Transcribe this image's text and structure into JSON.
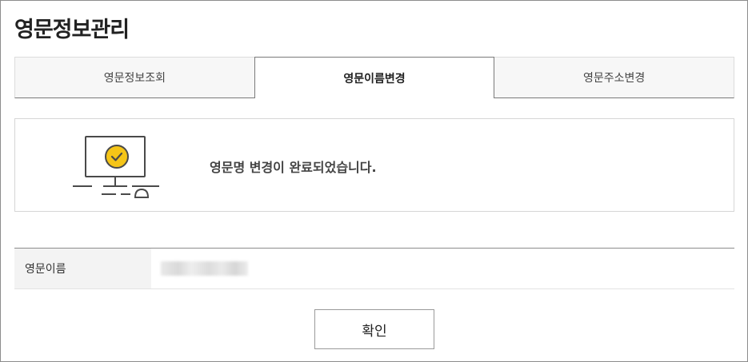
{
  "page": {
    "title": "영문정보관리"
  },
  "tabs": [
    {
      "label": "영문정보조회",
      "active": false
    },
    {
      "label": "영문이름변경",
      "active": true
    },
    {
      "label": "영문주소변경",
      "active": false
    }
  ],
  "result": {
    "message": "영문명 변경이 완료되었습니다.",
    "icon": "monitor-check-icon",
    "accent_color": "#f5c518"
  },
  "info": {
    "label": "영문이름",
    "value": ""
  },
  "actions": {
    "confirm_label": "확인"
  }
}
